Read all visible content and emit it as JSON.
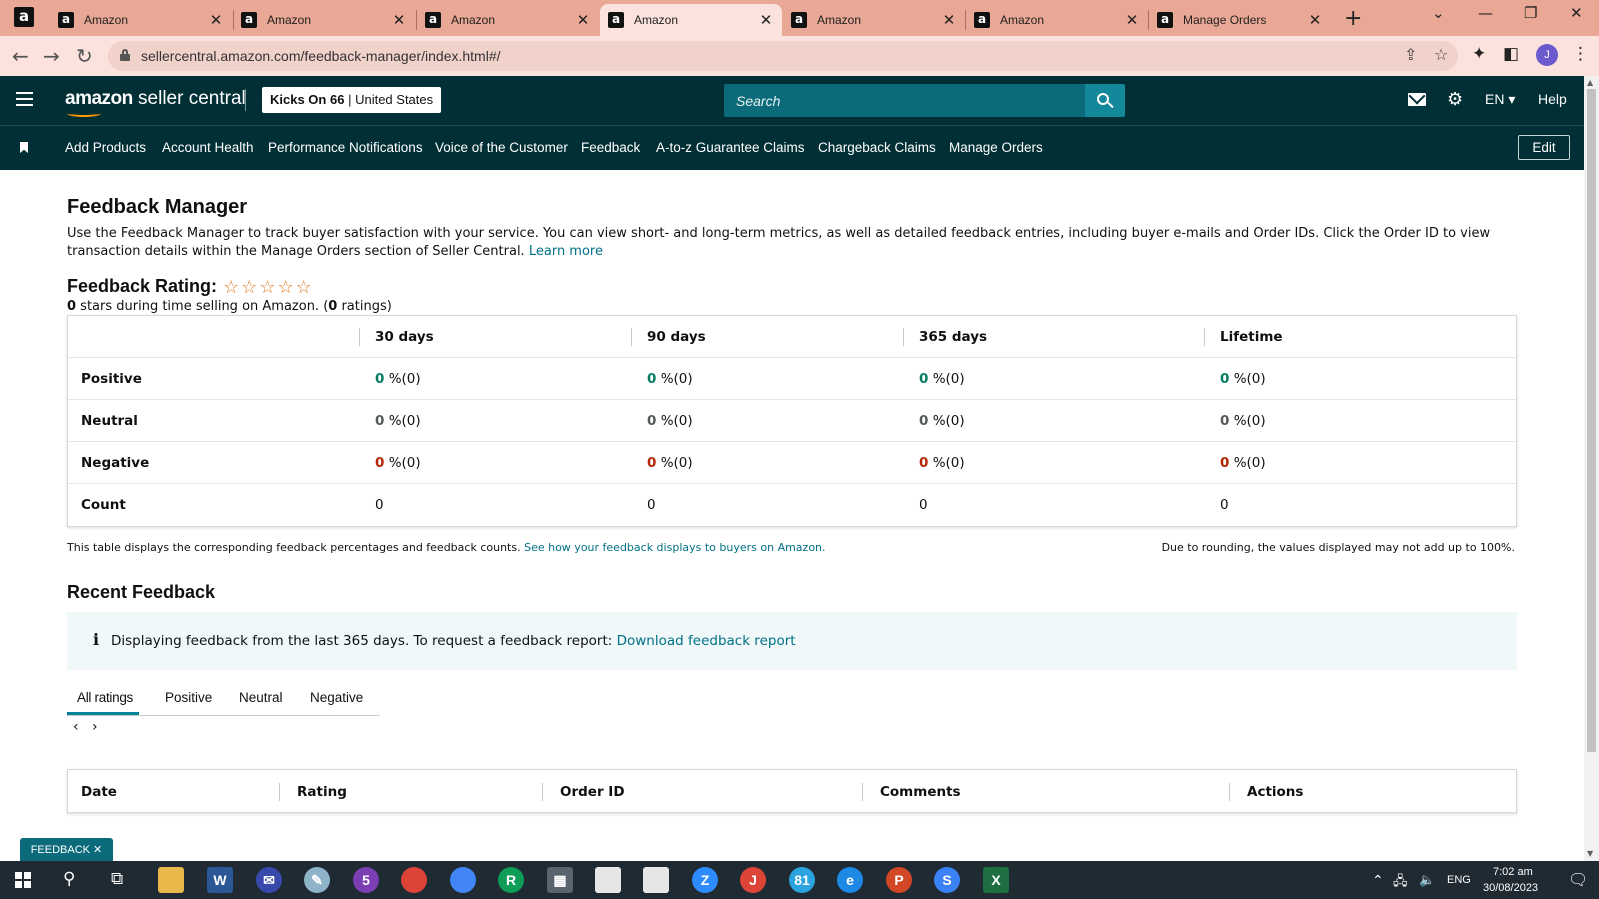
{
  "browser": {
    "pinned_tab_glyph": "a",
    "tabs": [
      {
        "title": "Amazon",
        "active": false
      },
      {
        "title": "Amazon",
        "active": false
      },
      {
        "title": "Amazon",
        "active": true
      },
      {
        "title": "Amazon",
        "active": false
      },
      {
        "title": "Amazon",
        "active": false
      },
      {
        "title": "Manage Orders",
        "active": false
      }
    ],
    "url": "sellercentral.amazon.com/feedback-manager/index.html#/",
    "profile_initial": "J",
    "colors": {
      "tabstrip": "#e9a896",
      "active_tab": "#fbe2dc"
    }
  },
  "header": {
    "logo_amazon": "amazon",
    "logo_product": "seller central",
    "store_name": "Kicks On 66",
    "store_sep": "|",
    "marketplace": "United States",
    "search_placeholder": "Search",
    "language": "EN",
    "help": "Help",
    "colors": {
      "bar": "#002f36",
      "search": "#0c6b7a",
      "search_button": "#14889b",
      "logo_smile": "#ff9900"
    }
  },
  "nav": {
    "items": [
      "Add Products",
      "Account Health",
      "Performance Notifications",
      "Voice of the Customer",
      "Feedback",
      "A-to-z Guarantee Claims",
      "Chargeback Claims",
      "Manage Orders"
    ],
    "edit": "Edit"
  },
  "page": {
    "title": "Feedback Manager",
    "intro": "Use the Feedback Manager to track buyer satisfaction with your service. You can view short- and long-term metrics, as well as detailed feedback entries, including buyer e-mails and Order IDs. Click the Order ID to view transaction details within the Manage Orders section of Seller Central.",
    "learn_more": "Learn more",
    "rating_label": "Feedback Rating:",
    "star_glyph": "☆",
    "stars_count": 0,
    "rating_sub_value": "0",
    "rating_sub_text": " stars during time selling on Amazon. (",
    "rating_sub_count": "0",
    "rating_sub_tail": " ratings)"
  },
  "feedback_table": {
    "columns": [
      "30 days",
      "90 days",
      "365 days",
      "Lifetime"
    ],
    "rows": [
      {
        "label": "Positive",
        "kind": "pos",
        "cells": [
          {
            "v": "0",
            "u": " %(0)"
          },
          {
            "v": "0",
            "u": " %(0)"
          },
          {
            "v": "0",
            "u": " %(0)"
          },
          {
            "v": "0",
            "u": " %(0)"
          }
        ]
      },
      {
        "label": "Neutral",
        "kind": "neu",
        "cells": [
          {
            "v": "0",
            "u": " %(0)"
          },
          {
            "v": "0",
            "u": " %(0)"
          },
          {
            "v": "0",
            "u": " %(0)"
          },
          {
            "v": "0",
            "u": " %(0)"
          }
        ]
      },
      {
        "label": "Negative",
        "kind": "neg",
        "cells": [
          {
            "v": "0",
            "u": " %(0)"
          },
          {
            "v": "0",
            "u": " %(0)"
          },
          {
            "v": "0",
            "u": " %(0)"
          },
          {
            "v": "0",
            "u": " %(0)"
          }
        ]
      },
      {
        "label": "Count",
        "kind": "count",
        "cells": [
          {
            "v": "0",
            "u": ""
          },
          {
            "v": "0",
            "u": ""
          },
          {
            "v": "0",
            "u": ""
          },
          {
            "v": "0",
            "u": ""
          }
        ]
      }
    ],
    "note": "This table displays the corresponding feedback percentages and feedback counts.",
    "note_link": "See how your feedback displays to buyers on Amazon.",
    "rounding_note": "Due to rounding, the values displayed may not add up to 100%.",
    "colors": {
      "positive": "#067d62",
      "negative": "#b12704",
      "neutral": "#565959"
    }
  },
  "recent": {
    "title": "Recent Feedback",
    "info_icon": "i",
    "info_text": "Displaying feedback from the last 365 days. To request a feedback report:",
    "info_link": "Download feedback report",
    "tabs": [
      "All ratings",
      "Positive",
      "Neutral",
      "Negative"
    ],
    "pager_prev": "‹",
    "pager_next": "›",
    "columns": [
      "Date",
      "Rating",
      "Order ID",
      "Comments",
      "Actions"
    ]
  },
  "floating": {
    "feedback_tab": "FEEDBACK ✕"
  },
  "taskbar": {
    "tray": {
      "lang": "ENG",
      "time": "7:02 am",
      "date": "30/08/2023"
    },
    "badges": {
      "chrome_r": "R",
      "chrome_j": "J",
      "telegram": "81",
      "messenger": "5"
    }
  }
}
